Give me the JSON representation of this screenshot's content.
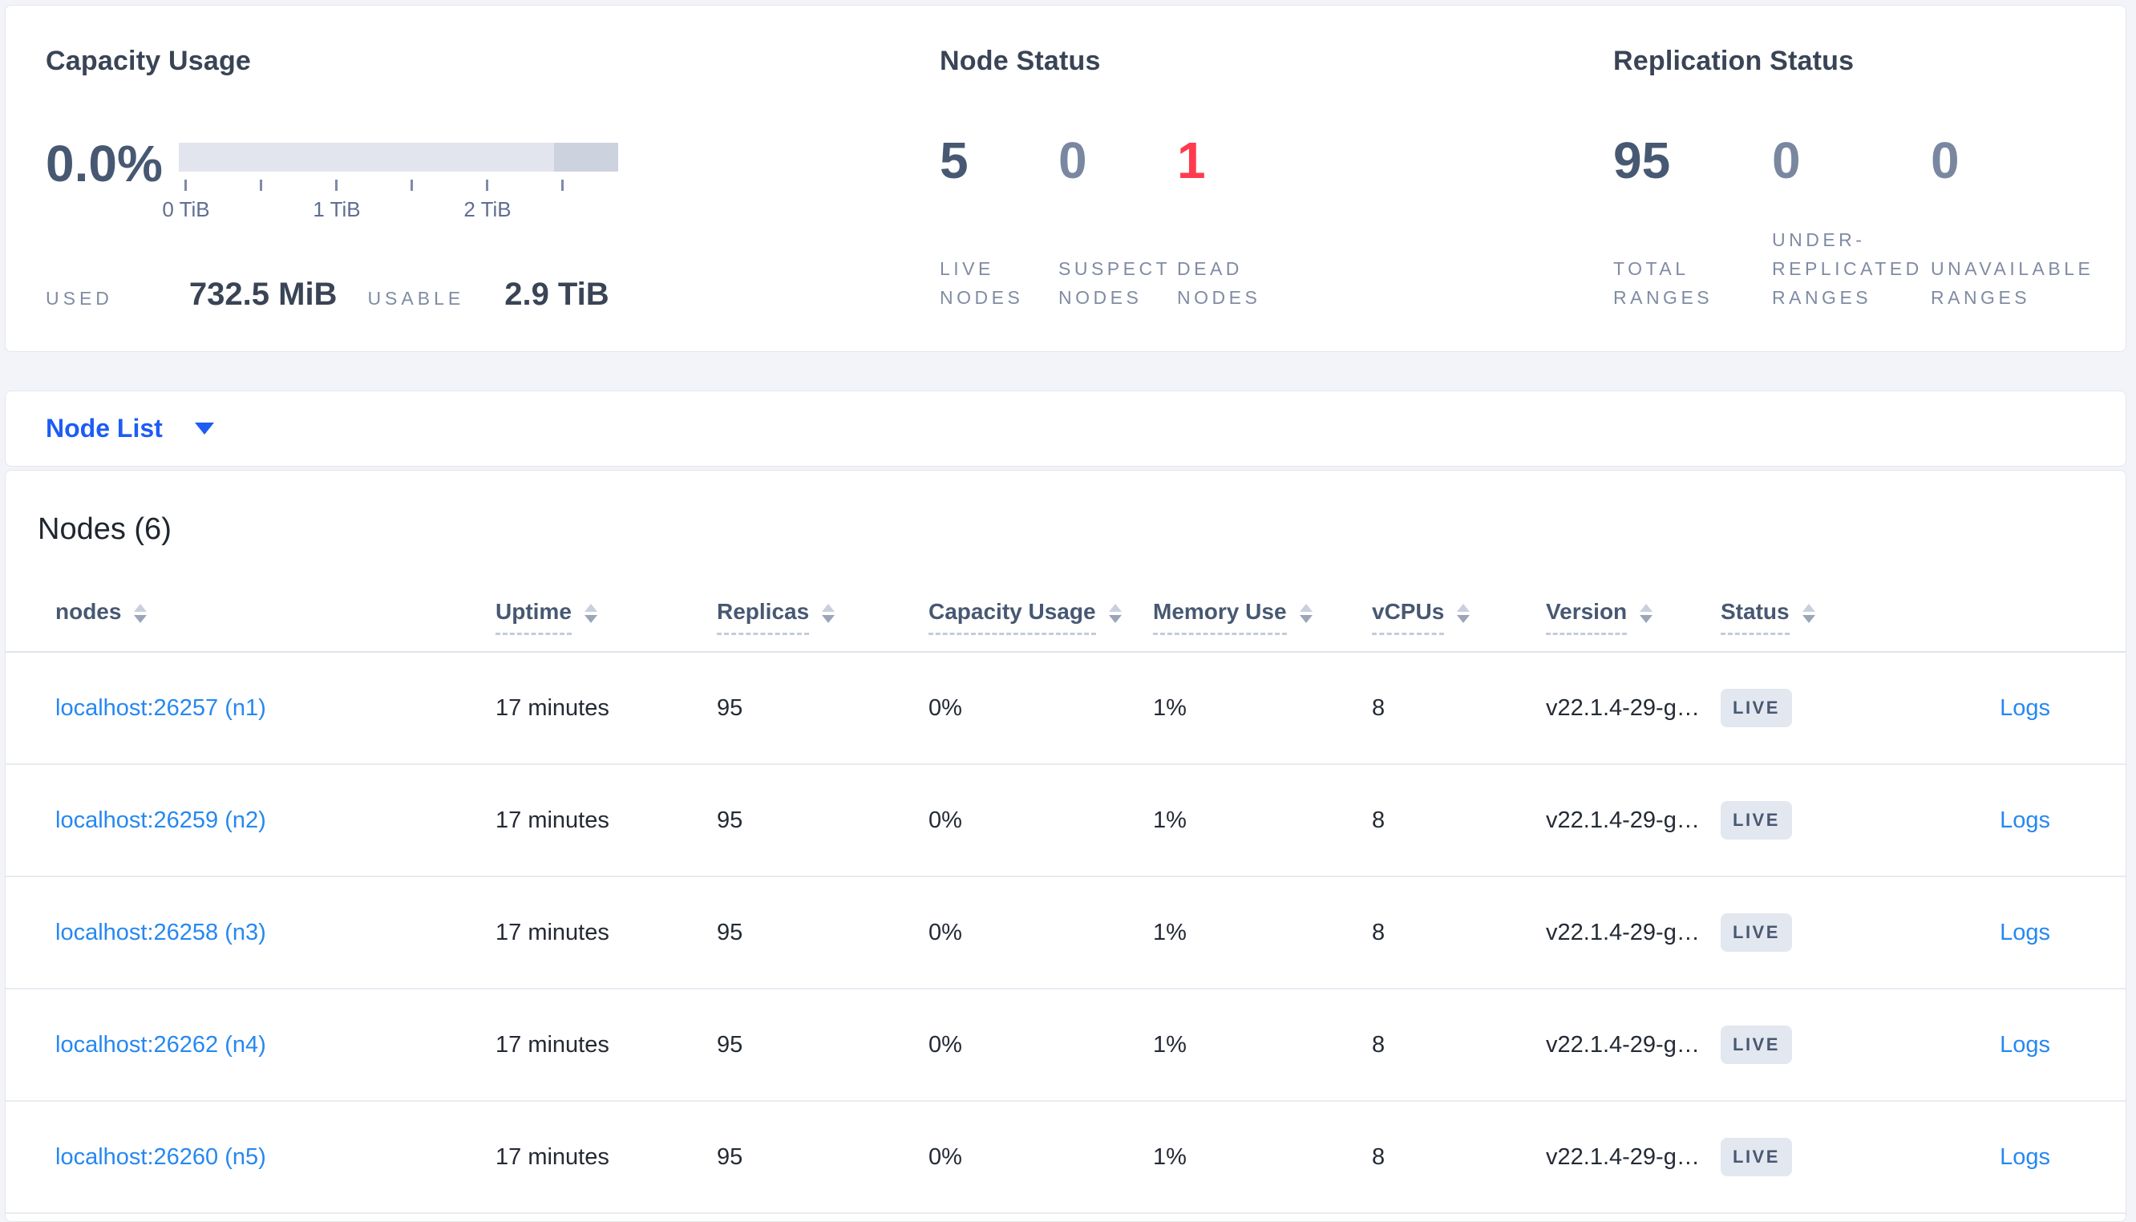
{
  "summary": {
    "capacity": {
      "title": "Capacity Usage",
      "percent": "0.0%",
      "used_label": "USED",
      "used_value": "732.5 MiB",
      "usable_label": "USABLE",
      "usable_value": "2.9 TiB",
      "axis_tick_labels": {
        "t0": "0 TiB",
        "t1": "1 TiB",
        "t2": "2 TiB"
      },
      "bar": {
        "track_color": "#e2e5ee",
        "reserved_color": "#cdd2df",
        "used_fraction": 0.0
      }
    },
    "node_status": {
      "title": "Node Status",
      "stats": [
        {
          "value": "5",
          "label": "LIVE NODES",
          "color": "#475872"
        },
        {
          "value": "0",
          "label": "SUSPECT NODES",
          "color": "#7a87a0"
        },
        {
          "value": "1",
          "label": "DEAD NODES",
          "color": "#ff3b4e"
        }
      ]
    },
    "replication_status": {
      "title": "Replication Status",
      "stats": [
        {
          "value": "95",
          "label": "TOTAL RANGES",
          "color": "#475872"
        },
        {
          "value": "0",
          "label": "UNDER-REPLICATED RANGES",
          "color": "#7a87a0"
        },
        {
          "value": "0",
          "label": "UNAVAILABLE RANGES",
          "color": "#7a87a0"
        }
      ]
    }
  },
  "view_selector": {
    "label": "Node List"
  },
  "nodes_section": {
    "title": "Nodes (6)",
    "columns": [
      {
        "label": "nodes",
        "underlined": false
      },
      {
        "label": "Uptime",
        "underlined": true
      },
      {
        "label": "Replicas",
        "underlined": true
      },
      {
        "label": "Capacity Usage",
        "underlined": true
      },
      {
        "label": "Memory Use",
        "underlined": true
      },
      {
        "label": "vCPUs",
        "underlined": true
      },
      {
        "label": "Version",
        "underlined": true
      },
      {
        "label": "Status",
        "underlined": true
      }
    ],
    "rows": [
      {
        "node": "localhost:26257 (n1)",
        "uptime": "17 minutes",
        "replicas": "95",
        "capacity_usage": "0%",
        "memory_use": "1%",
        "vcpus": "8",
        "version": "v22.1.4-29-g…",
        "status": "LIVE",
        "logs_label": "Logs"
      },
      {
        "node": "localhost:26259 (n2)",
        "uptime": "17 minutes",
        "replicas": "95",
        "capacity_usage": "0%",
        "memory_use": "1%",
        "vcpus": "8",
        "version": "v22.1.4-29-g…",
        "status": "LIVE",
        "logs_label": "Logs"
      },
      {
        "node": "localhost:26258 (n3)",
        "uptime": "17 minutes",
        "replicas": "95",
        "capacity_usage": "0%",
        "memory_use": "1%",
        "vcpus": "8",
        "version": "v22.1.4-29-g…",
        "status": "LIVE",
        "logs_label": "Logs"
      },
      {
        "node": "localhost:26262 (n4)",
        "uptime": "17 minutes",
        "replicas": "95",
        "capacity_usage": "0%",
        "memory_use": "1%",
        "vcpus": "8",
        "version": "v22.1.4-29-g…",
        "status": "LIVE",
        "logs_label": "Logs"
      },
      {
        "node": "localhost:26260 (n5)",
        "uptime": "17 minutes",
        "replicas": "95",
        "capacity_usage": "0%",
        "memory_use": "1%",
        "vcpus": "8",
        "version": "v22.1.4-29-g…",
        "status": "LIVE",
        "logs_label": "Logs"
      }
    ],
    "colors": {
      "link": "#2688f0",
      "badge_bg": "#e3e7ef",
      "badge_text": "#475872"
    }
  }
}
